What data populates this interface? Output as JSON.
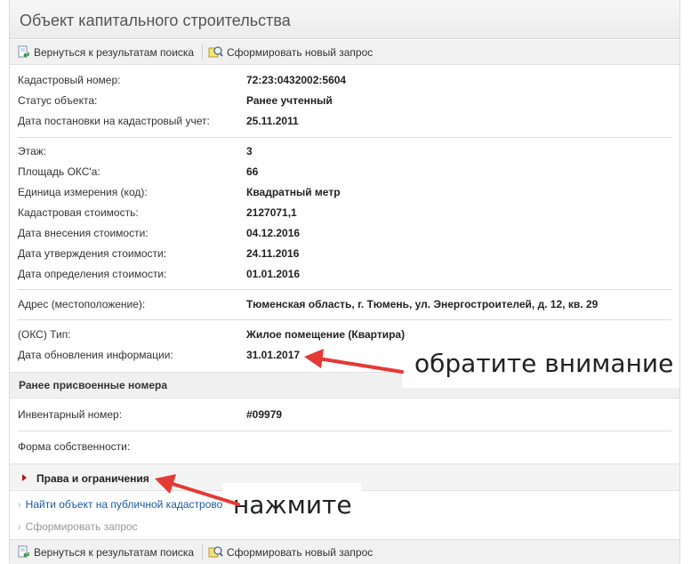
{
  "page": {
    "title": "Объект капитального строительства"
  },
  "toolbar": {
    "back_label": "Вернуться к результатам поиска",
    "new_request_label": "Сформировать новый запрос"
  },
  "info_group1": [
    {
      "label": "Кадастровый номер:",
      "value": "72:23:0432002:5604"
    },
    {
      "label": "Статус объекта:",
      "value": "Ранее учтенный"
    },
    {
      "label": "Дата постановки на кадастровый учет:",
      "value": "25.11.2011"
    }
  ],
  "info_group2": [
    {
      "label": "Этаж:",
      "value": "3"
    },
    {
      "label": "Площадь ОКС'а:",
      "value": "66"
    },
    {
      "label": "Единица измерения (код):",
      "value": "Квадратный метр"
    },
    {
      "label": "Кадастровая стоимость:",
      "value": "2127071,1"
    },
    {
      "label": "Дата внесения стоимости:",
      "value": "04.12.2016"
    },
    {
      "label": "Дата утверждения стоимости:",
      "value": "24.11.2016"
    },
    {
      "label": "Дата определения стоимости:",
      "value": "01.01.2016"
    }
  ],
  "address": {
    "label": "Адрес (местоположение):",
    "value": "Тюменская область, г. Тюмень, ул. Энергостроителей, д. 12, кв. 29"
  },
  "info_group3": [
    {
      "label": "(ОКС) Тип:",
      "value": "Жилое помещение  (Квартира)"
    },
    {
      "label": "Дата обновления информации:",
      "value": "31.01.2017"
    }
  ],
  "prior_numbers": {
    "header": "Ранее присвоенные номера",
    "label": "Инвентарный номер:",
    "value": "#09979"
  },
  "ownership": {
    "label": "Форма собственности:",
    "value": ""
  },
  "rights": {
    "header": "Права и ограничения"
  },
  "links": {
    "find_on_map": "Найти объект на публичной кадастровой карте",
    "make_request": "Сформировать запрос"
  },
  "annotations": {
    "attention": "обратите внимание",
    "click": "нажмите",
    "arrow_color": "#e53935"
  },
  "colors": {
    "link": "#1a5a9c",
    "accent_triangle": "#b2191b"
  }
}
